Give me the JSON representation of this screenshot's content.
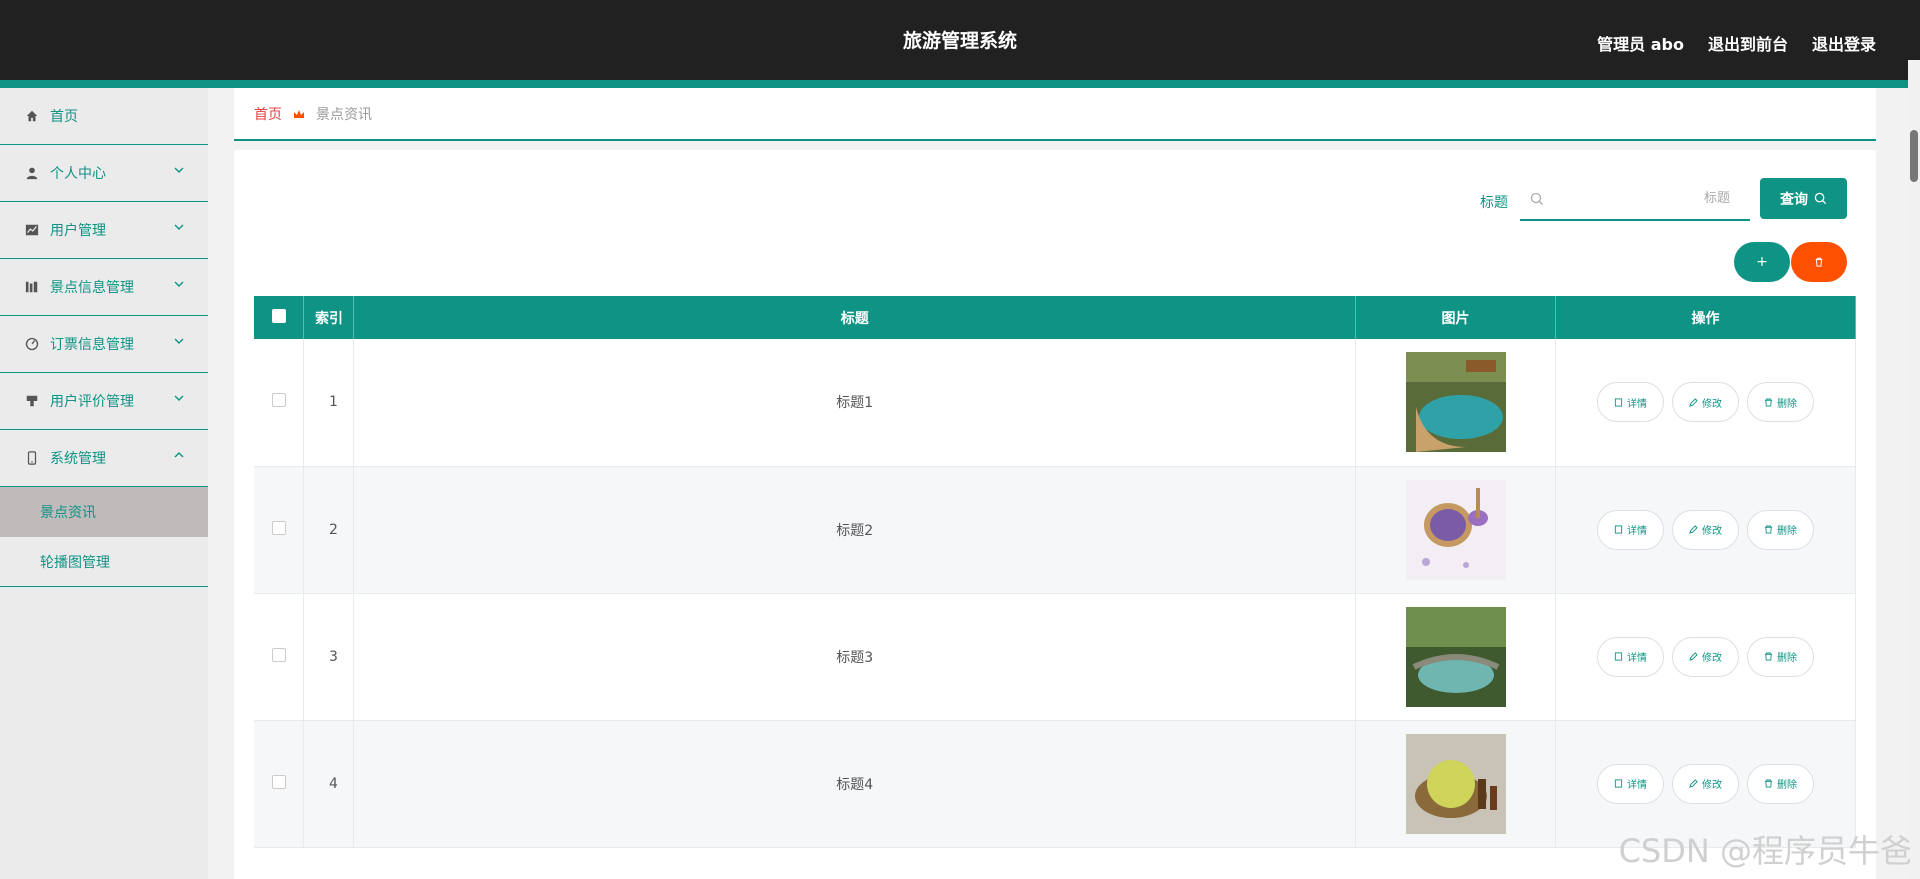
{
  "header": {
    "title": "旅游管理系统",
    "admin_label": "管理员 abo",
    "to_front": "退出到前台",
    "logout": "退出登录"
  },
  "sidebar": {
    "items": [
      {
        "label": "首页",
        "icon": "home-icon"
      },
      {
        "label": "个人中心",
        "icon": "user-icon"
      },
      {
        "label": "用户管理",
        "icon": "chart-icon"
      },
      {
        "label": "景点信息管理",
        "icon": "library-icon"
      },
      {
        "label": "订票信息管理",
        "icon": "gauge-icon"
      },
      {
        "label": "用户评价管理",
        "icon": "stamp-icon"
      },
      {
        "label": "系统管理",
        "icon": "phone-icon"
      }
    ],
    "sub_items": [
      {
        "label": "景点资讯",
        "active": true
      },
      {
        "label": "轮播图管理",
        "active": false
      }
    ]
  },
  "breadcrumb": {
    "home": "首页",
    "current": "景点资讯"
  },
  "search": {
    "label": "标题",
    "placeholder": "标题",
    "button": "查询"
  },
  "actions": {
    "add": "+"
  },
  "table": {
    "headers": [
      "索引",
      "标题",
      "图片",
      "操作"
    ],
    "rows": [
      {
        "index": "1",
        "title": "标题1"
      },
      {
        "index": "2",
        "title": "标题2"
      },
      {
        "index": "3",
        "title": "标题3"
      },
      {
        "index": "4",
        "title": "标题4"
      }
    ],
    "op_labels": {
      "detail": "详情",
      "edit": "修改",
      "delete": "删除"
    }
  },
  "watermark": "CSDN @程序员牛爸",
  "colors": {
    "accent": "#0e9384",
    "danger": "#ff4f00",
    "topbar": "#212121"
  }
}
